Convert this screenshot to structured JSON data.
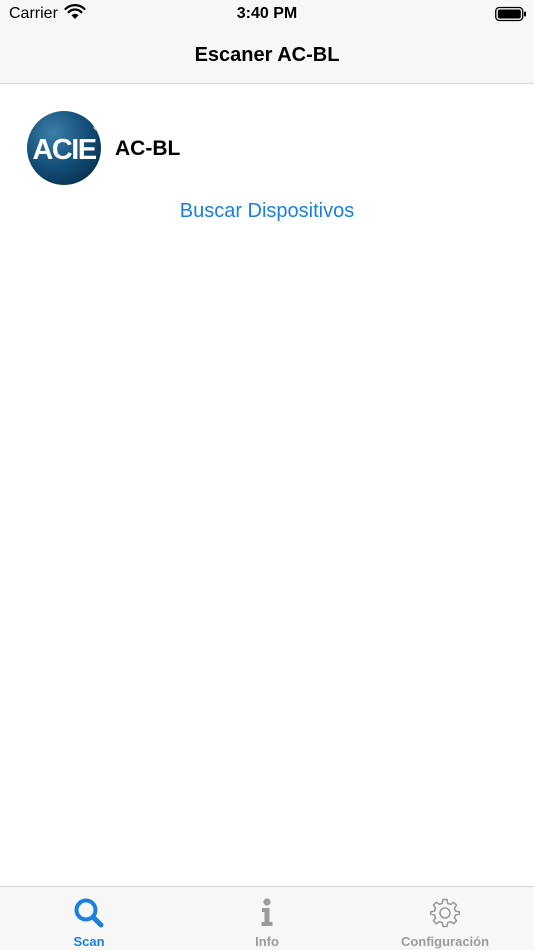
{
  "status_bar": {
    "carrier": "Carrier",
    "time": "3:40 PM"
  },
  "nav": {
    "title": "Escaner AC-BL"
  },
  "content": {
    "logo_text": "ACIE",
    "app_name": "AC-BL",
    "search_link": "Buscar Dispositivos"
  },
  "tabs": [
    {
      "label": "Scan",
      "icon": "search-icon",
      "active": true
    },
    {
      "label": "Info",
      "icon": "info-icon",
      "active": false
    },
    {
      "label": "Configuración",
      "icon": "gear-icon",
      "active": false
    }
  ],
  "colors": {
    "accent": "#1a7fe0",
    "inactive": "#9b9b9b",
    "bar_background": "#f7f7f7"
  }
}
